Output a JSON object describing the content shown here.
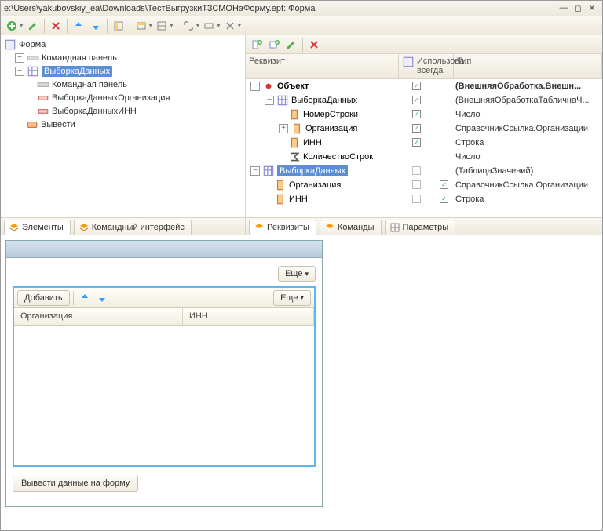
{
  "title": "e:\\Users\\yakubovskiy_ea\\Downloads\\ТестВыгрузкиТЗСМОНаФорму.epf: Форма",
  "left_tree": {
    "root": "Форма",
    "items": [
      "Командная панель",
      "ВыборкаДанных",
      "Командная панель",
      "ВыборкаДанныхОрганизация",
      "ВыборкаДанныхИНН",
      "Вывести"
    ]
  },
  "right_head": {
    "c1": "Реквизит",
    "c2": "Использова... всегда",
    "c3": "Тип"
  },
  "right_rows": [
    {
      "indent": 0,
      "tw": "−",
      "ic": "dot",
      "label": "Объект",
      "bold": true,
      "c1": "on",
      "c2": "",
      "type": "(ВнешняяОбработка.Внешн..."
    },
    {
      "indent": 1,
      "tw": "−",
      "ic": "tbl",
      "label": "ВыборкаДанных",
      "c1": "on",
      "c2": "",
      "type": "(ВнешняяОбработкаТабличнаЧ..."
    },
    {
      "indent": 2,
      "tw": "",
      "ic": "col",
      "label": "НомерСтроки",
      "c1": "on",
      "c2": "",
      "type": "Число"
    },
    {
      "indent": 2,
      "tw": "+",
      "ic": "col",
      "label": "Организация",
      "c1": "on",
      "c2": "",
      "type": "СправочникСсылка.Организации"
    },
    {
      "indent": 2,
      "tw": "",
      "ic": "col",
      "label": "ИНН",
      "c1": "on",
      "c2": "",
      "type": "Строка"
    },
    {
      "indent": 2,
      "tw": "",
      "ic": "sig",
      "label": "КоличествоСтрок",
      "c1": "",
      "c2": "",
      "type": "Число"
    },
    {
      "indent": 0,
      "tw": "−",
      "ic": "tbl",
      "label": "ВыборкаДанных",
      "sel": true,
      "c1": "off",
      "c2": "",
      "type": "(ТаблицаЗначений)"
    },
    {
      "indent": 1,
      "tw": "",
      "ic": "col",
      "label": "Организация",
      "c1": "off",
      "c2": "on",
      "type": "СправочникСсылка.Организации"
    },
    {
      "indent": 1,
      "tw": "",
      "ic": "col",
      "label": "ИНН",
      "c1": "off",
      "c2": "on",
      "type": "Строка"
    }
  ],
  "tabs_left": [
    "Элементы",
    "Командный интерфейс"
  ],
  "tabs_right": [
    "Реквизиты",
    "Команды",
    "Параметры"
  ],
  "preview": {
    "more": "Еще",
    "add": "Добавить",
    "col1": "Организация",
    "col2": "ИНН",
    "action_btn": "Вывести данные на форму"
  }
}
